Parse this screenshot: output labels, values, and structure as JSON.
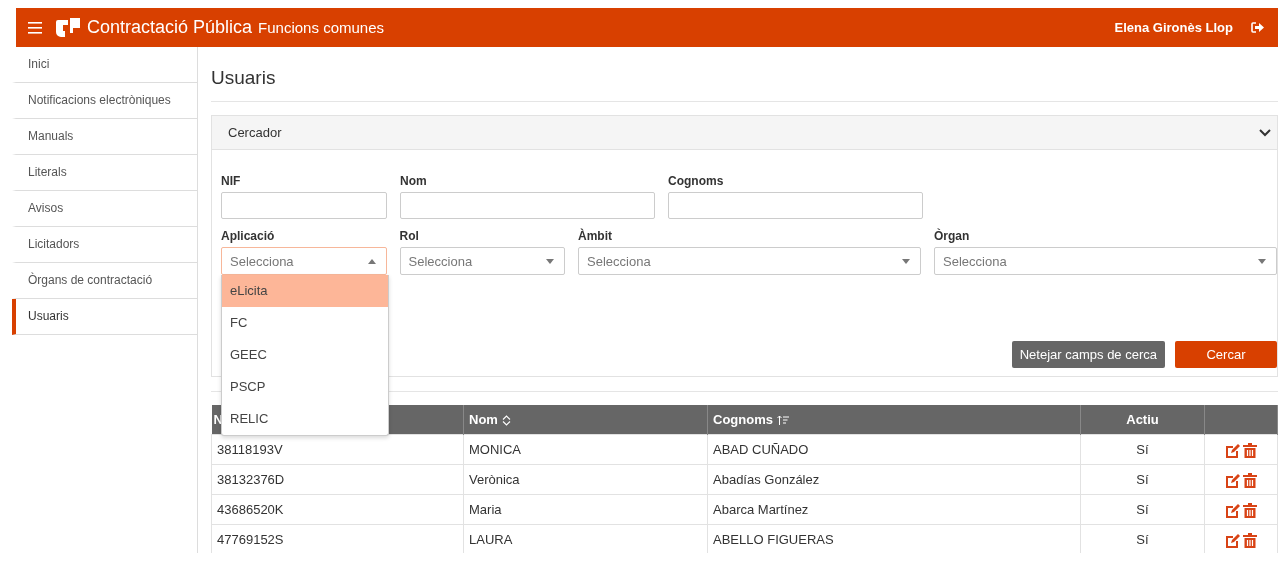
{
  "header": {
    "app_title": "Contractació Pública",
    "module": "Funcions comunes",
    "user": "Elena Gironès Llop"
  },
  "sidebar": {
    "items": [
      {
        "label": "Inici",
        "selected": false
      },
      {
        "label": "Notificacions electròniques",
        "selected": false
      },
      {
        "label": "Manuals",
        "selected": false
      },
      {
        "label": "Literals",
        "selected": false
      },
      {
        "label": "Avisos",
        "selected": false
      },
      {
        "label": "Licitadors",
        "selected": false
      },
      {
        "label": "Òrgans de contractació",
        "selected": false
      },
      {
        "label": "Usuaris",
        "selected": true
      }
    ]
  },
  "page_title": "Usuaris",
  "search_panel": {
    "title": "Cercador",
    "expanded": true,
    "rows": [
      [
        {
          "kind": "text",
          "label": "NIF"
        },
        {
          "kind": "text",
          "label": "Nom"
        },
        {
          "kind": "text",
          "label": "Cognoms"
        }
      ],
      [
        {
          "kind": "select",
          "label": "Aplicació",
          "placeholder": "Selecciona",
          "expanded": true,
          "options": [
            {
              "label": "eLicita",
              "selected": true
            },
            {
              "label": "FC",
              "selected": false
            },
            {
              "label": "GEEC",
              "selected": false
            },
            {
              "label": "PSCP",
              "selected": false
            },
            {
              "label": "RELIC",
              "selected": false
            }
          ]
        },
        {
          "kind": "select",
          "label": "Rol",
          "placeholder": "Selecciona",
          "expanded": false
        },
        {
          "kind": "select",
          "label": "Àmbit",
          "placeholder": "Selecciona",
          "expanded": false
        },
        {
          "kind": "select",
          "label": "Òrgan",
          "placeholder": "Selecciona",
          "expanded": false
        }
      ]
    ],
    "buttons": [
      {
        "label": "Netejar camps de cerca",
        "kind": "secondary"
      },
      {
        "label": "Cercar",
        "kind": "primary"
      }
    ]
  },
  "table": {
    "columns": [
      {
        "label": "N",
        "sortable": false,
        "sorted_ascending": false
      },
      {
        "label": "Nom",
        "sortable": true,
        "sorted_ascending": false
      },
      {
        "label": "Cognoms",
        "sortable": true,
        "sorted_ascending": true
      },
      {
        "label": "Actiu",
        "sortable": false,
        "sorted_ascending": false
      }
    ],
    "rows": [
      [
        "38118193V",
        "MONICA",
        "ABAD CUÑADO",
        "Sí"
      ],
      [
        "38132376D",
        "Verònica",
        "Abadías González",
        "Sí"
      ],
      [
        "43686520K",
        "Maria",
        "Abarca Martínez",
        "Sí"
      ],
      [
        "47769152S",
        "LAURA",
        "ABELLO FIGUERAS",
        "Sí"
      ]
    ]
  }
}
